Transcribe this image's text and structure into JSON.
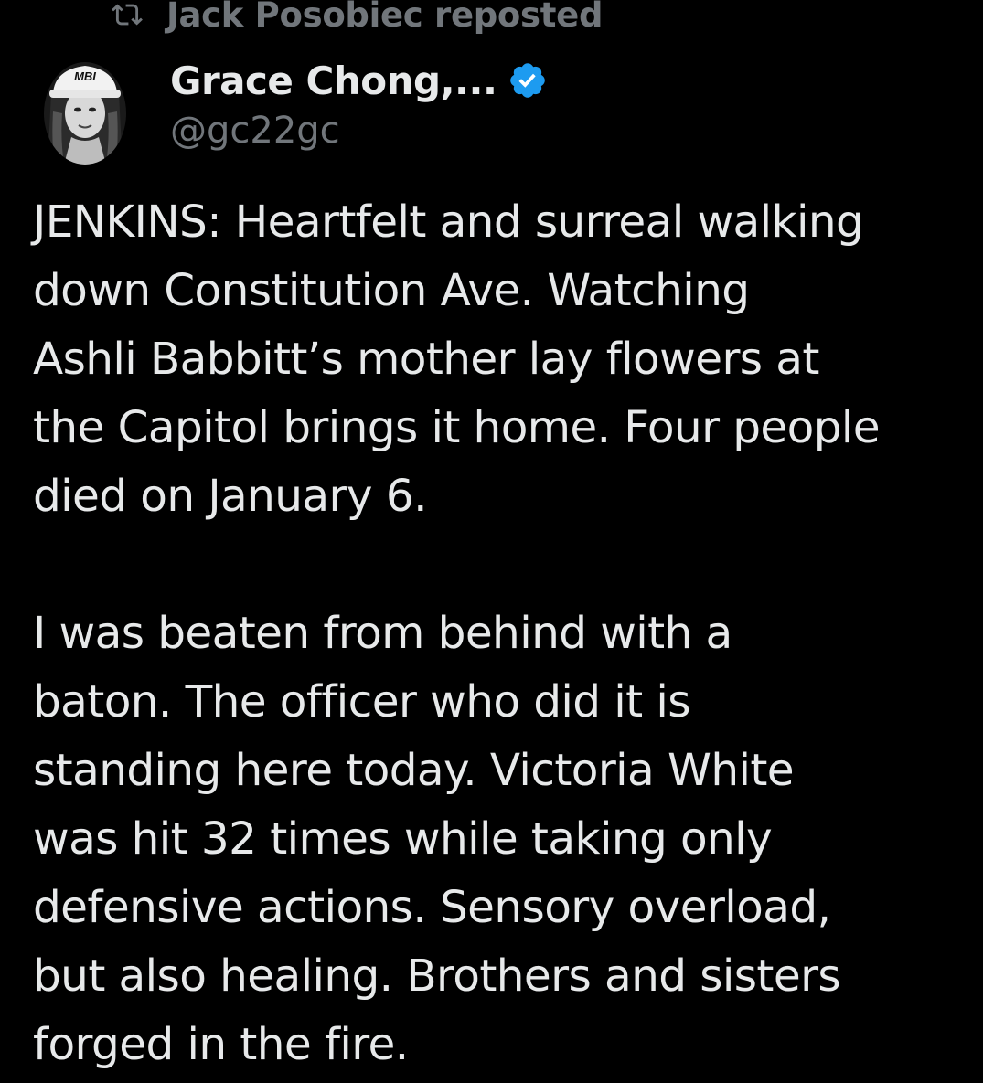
{
  "repost": {
    "text": "Jack Posobiec reposted",
    "icon": "repost-icon"
  },
  "author": {
    "display_name": "Grace Chong,...",
    "handle": "@gc22gc",
    "verified_icon": "verified-badge-icon",
    "verified_color": "#1d9bf0",
    "avatar_hat_text": "MBI"
  },
  "tweet": {
    "paragraphs": [
      {
        "lines": [
          "JENKINS: Heartfelt and surreal walking",
          "down Constitution Ave. Watching",
          "Ashli Babbitt’s mother lay flowers at",
          "the Capitol brings it home. Four people",
          "died on January 6."
        ]
      },
      {
        "lines": [
          "I was beaten from behind with a",
          "baton. The officer who did it is",
          "standing here today. Victoria White",
          "was hit 32 times while taking only",
          "defensive actions. Sensory overload,",
          "but also healing. Brothers and sisters",
          "forged in the fire."
        ]
      }
    ]
  },
  "colors": {
    "background": "#000000",
    "text_primary": "#e7e9ea",
    "text_secondary": "#71767b"
  }
}
